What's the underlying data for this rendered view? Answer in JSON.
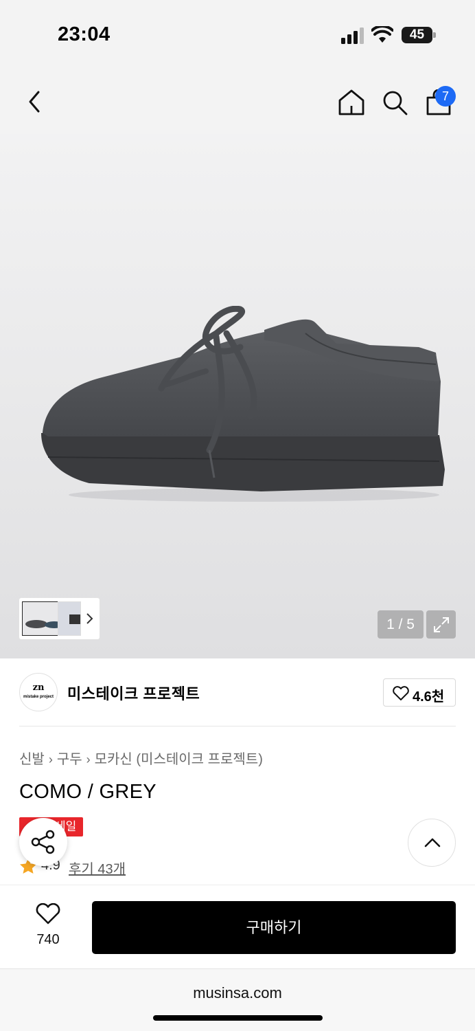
{
  "status": {
    "time": "23:04",
    "battery": "45"
  },
  "nav": {
    "cart_count": "7"
  },
  "gallery": {
    "counter": "1 / 5"
  },
  "brand": {
    "logo_mark": "zn",
    "logo_sub": "mistake project",
    "name": "미스테이크 프로젝트",
    "likes": "4.6천"
  },
  "breadcrumb": [
    "신발",
    "구두",
    "모카신 (미스테이크 프로젝트)"
  ],
  "product": {
    "name": "COMO / GREY",
    "badge": "세일",
    "rating": "4.9",
    "reviews": "후기 43개"
  },
  "buy_bar": {
    "wish_count": "740",
    "buy_label": "구매하기"
  },
  "browser": {
    "url": "musinsa.com"
  },
  "colors": {
    "badge_blue": "#1d6af5",
    "sale_red": "#e8262b",
    "star": "#f5a623"
  }
}
